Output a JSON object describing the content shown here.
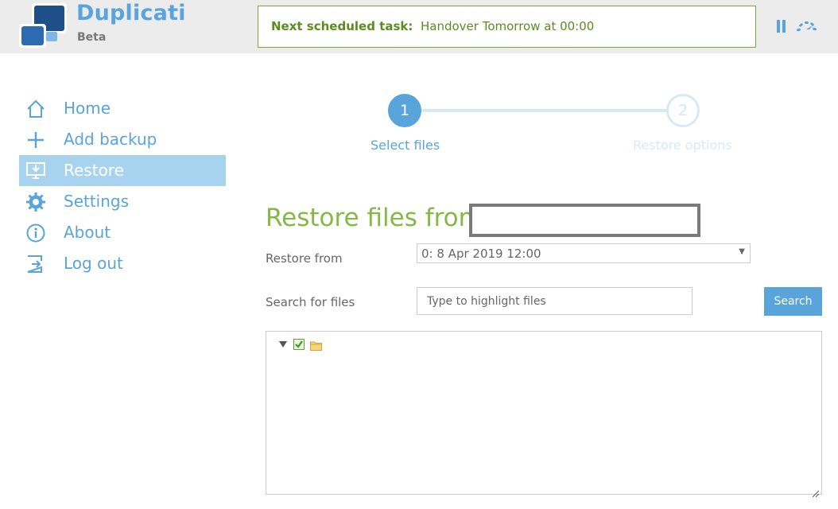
{
  "header": {
    "app_title": "Duplicati",
    "app_subtitle": "Beta",
    "schedule_label": "Next scheduled task:",
    "schedule_value": "Handover Tomorrow at 00:00",
    "pause_icon": "pause-icon",
    "throttle_icon": "speedometer-icon"
  },
  "sidebar": {
    "items": [
      {
        "label": "Home",
        "icon": "home-icon",
        "active": false
      },
      {
        "label": "Add backup",
        "icon": "plus-icon",
        "active": false
      },
      {
        "label": "Restore",
        "icon": "restore-icon",
        "active": true
      },
      {
        "label": "Settings",
        "icon": "gear-icon",
        "active": false
      },
      {
        "label": "About",
        "icon": "info-icon",
        "active": false
      },
      {
        "label": "Log out",
        "icon": "logout-icon",
        "active": false
      }
    ]
  },
  "stepper": {
    "steps": [
      {
        "number": "1",
        "label": "Select files",
        "active": true
      },
      {
        "number": "2",
        "label": "Restore options",
        "active": false
      }
    ]
  },
  "main": {
    "title": "Restore files from",
    "restore_from_label": "Restore from",
    "restore_from_value": "0: 8 Apr 2019 12:00",
    "search_label": "Search for files",
    "search_placeholder": "Type to highlight files",
    "search_button": "Search"
  },
  "colors": {
    "accent": "#5aa4dc",
    "active_nav": "#a8d3ee",
    "title_green": "#85b846",
    "schedule_green": "#5b8c1f"
  }
}
